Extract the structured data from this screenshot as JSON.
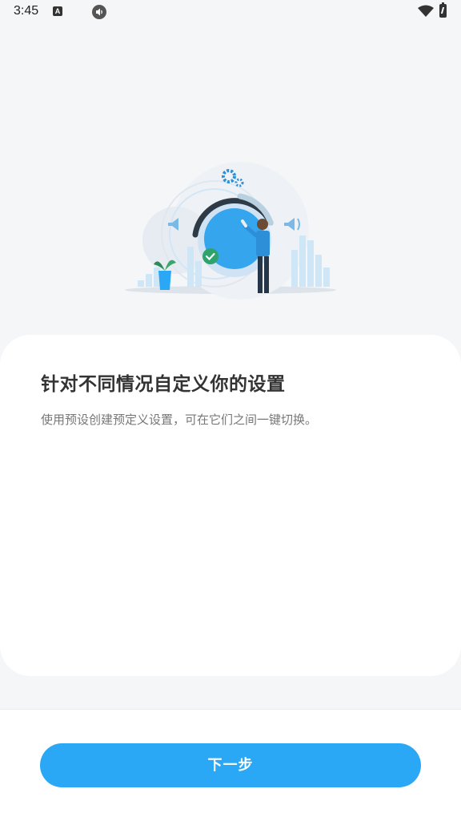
{
  "status_bar": {
    "time": "3:45",
    "notification_letter": "A"
  },
  "illustration": {
    "icon": "volume-knob-illustration"
  },
  "card": {
    "title": "针对不同情况自定义你的设置",
    "description": "使用预设创建预定义设置，可在它们之间一键切换。"
  },
  "footer": {
    "next_label": "下一步"
  },
  "colors": {
    "accent": "#2ba8f5",
    "background": "#f5f6f8",
    "card": "#ffffff"
  }
}
